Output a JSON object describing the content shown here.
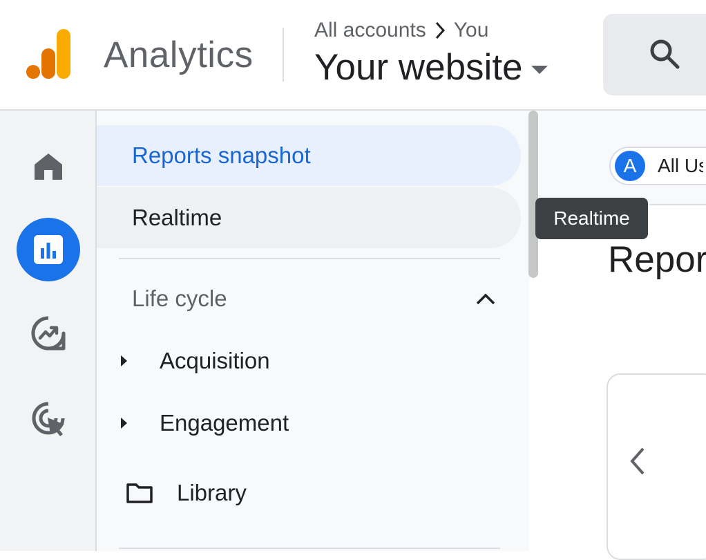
{
  "header": {
    "app_name": "Analytics",
    "breadcrumb": {
      "root": "All accounts",
      "account": "You"
    },
    "property_name": "Your website"
  },
  "nav": {
    "items": [
      {
        "label": "Reports snapshot",
        "active": true
      },
      {
        "label": "Realtime",
        "active": false
      }
    ],
    "section": {
      "title": "Life cycle",
      "expanded": true,
      "items": [
        {
          "label": "Acquisition"
        },
        {
          "label": "Engagement"
        }
      ]
    },
    "library_label": "Library"
  },
  "rail": {
    "icons": [
      "home-icon",
      "reports-icon",
      "explore-icon",
      "advertising-icon"
    ],
    "active": "reports-icon"
  },
  "main": {
    "comparison_chip": {
      "avatar_letter": "A",
      "label": "All Users"
    },
    "page_title": "Reports snapshot"
  },
  "tooltip": {
    "text": "Realtime"
  },
  "colors": {
    "accent": "#1a73e8",
    "active_text": "#1967d2",
    "logo_orange_dark": "#e37400",
    "logo_orange": "#f9ab00"
  }
}
